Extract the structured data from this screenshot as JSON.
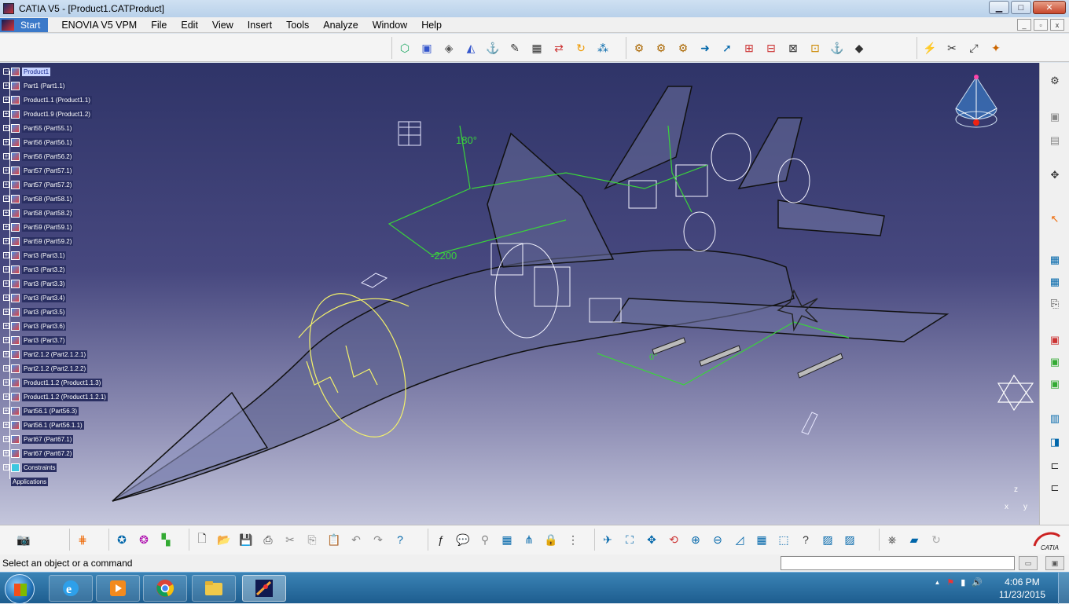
{
  "window": {
    "title": "CATIA V5 - [Product1.CATProduct]",
    "min": "▁",
    "max": "□",
    "close": "✕"
  },
  "menu": {
    "start": "Start",
    "items": [
      "ENOVIA V5 VPM",
      "File",
      "Edit",
      "View",
      "Insert",
      "Tools",
      "Analyze",
      "Window",
      "Help"
    ]
  },
  "tree": {
    "nodes": [
      "Product1",
      "Part1 (Part1.1)",
      "Product1.1 (Product1.1)",
      "Product1.9 (Product1.2)",
      "Part55 (Part55.1)",
      "Part56 (Part56.1)",
      "Part56 (Part56.2)",
      "Part57 (Part57.1)",
      "Part57 (Part57.2)",
      "Part58 (Part58.1)",
      "Part58 (Part58.2)",
      "Part59 (Part59.1)",
      "Part59 (Part59.2)",
      "Part3 (Part3.1)",
      "Part3 (Part3.2)",
      "Part3 (Part3.3)",
      "Part3 (Part3.4)",
      "Part3 (Part3.5)",
      "Part3 (Part3.6)",
      "Part3 (Part3.7)",
      "Part2.1.2 (Part2.1.2.1)",
      "Part2.1.2 (Part2.1.2.2)",
      "Product1.1.2 (Product1.1.3)",
      "Product1.1.2 (Product1.1.2.1)",
      "Part56.1 (Part56.3)",
      "Part56.1 (Part56.1.1)",
      "Part67 (Part67.1)",
      "Part67 (Part67.2)",
      "Constraints"
    ],
    "applications": "Applications"
  },
  "viewport": {
    "angle_label": "180°",
    "distance_label": "-2200",
    "zero_angle_label": "0°",
    "axis_x": "x",
    "axis_y": "y",
    "axis_z": "z"
  },
  "colors": {
    "constraint": "#3ad43a",
    "wire": "#f0f0ff",
    "highlight": "#ffff66"
  },
  "status": {
    "message": "Select an object or a command"
  },
  "taskbar": {
    "time": "4:06 PM",
    "date": "11/23/2015",
    "tray_up": "▲"
  }
}
